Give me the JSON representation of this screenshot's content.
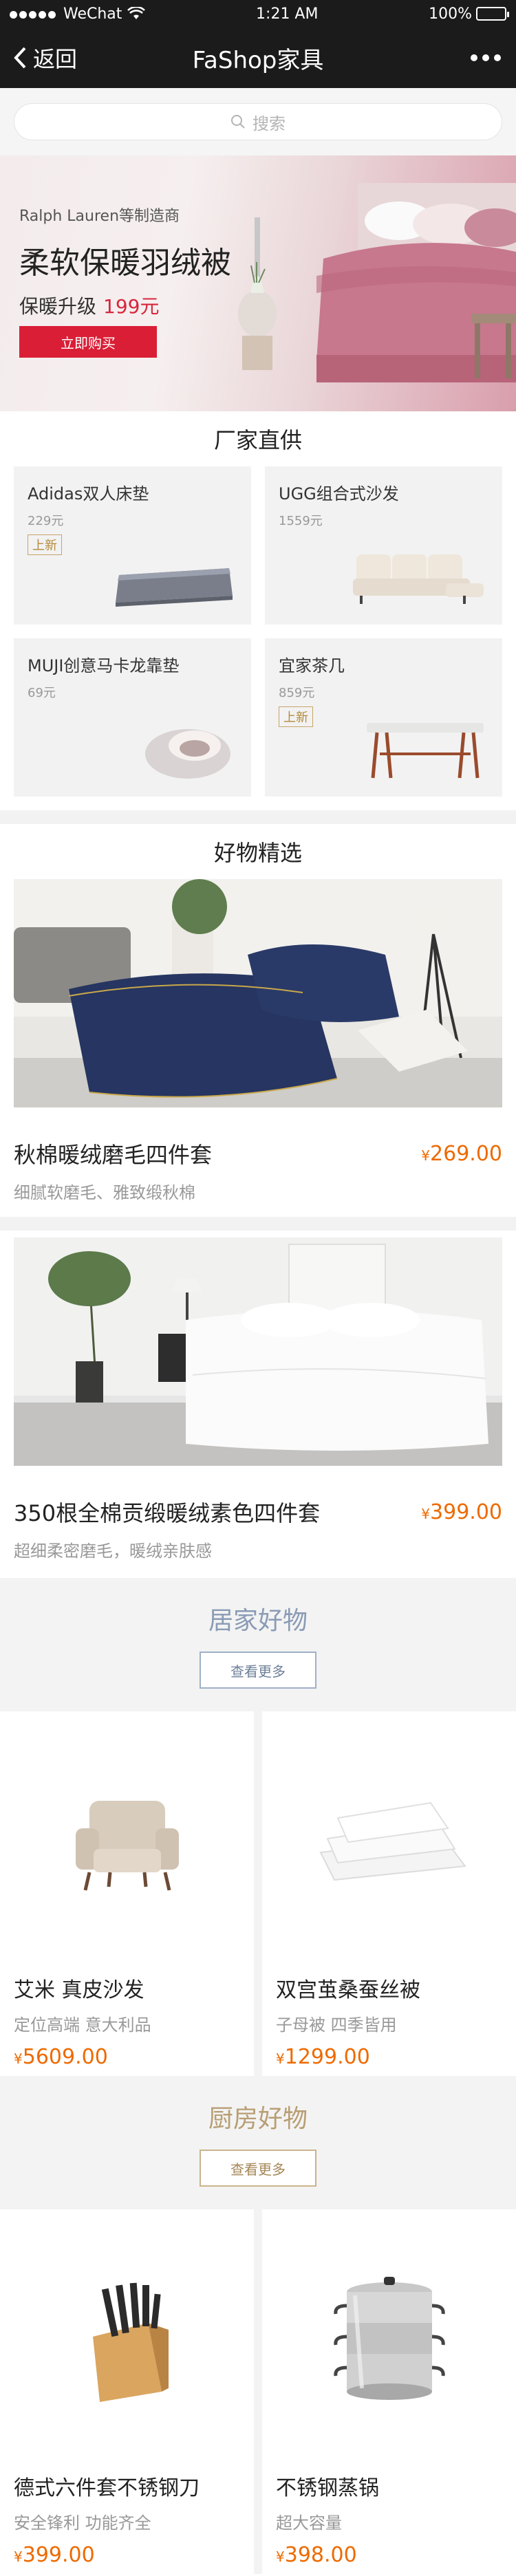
{
  "status_bar": {
    "carrier": "WeChat",
    "time": "1:21 AM",
    "battery": "100%"
  },
  "nav": {
    "back_label": "返回",
    "title": "FaShop家具"
  },
  "search": {
    "placeholder": "搜索"
  },
  "banner": {
    "subtitle": "Ralph Lauren等制造商",
    "title": "柔软保暖羽绒被",
    "price_label": "保暖升级",
    "price": "199元",
    "button": "立即购买"
  },
  "factory": {
    "heading": "厂家直供",
    "items": [
      {
        "name": "Adidas双人床垫",
        "price": "229元",
        "badge": "上新"
      },
      {
        "name": "UGG组合式沙发",
        "price": "1559元",
        "badge": ""
      },
      {
        "name": "MUJI创意马卡龙靠垫",
        "price": "69元",
        "badge": ""
      },
      {
        "name": "宜家茶几",
        "price": "859元",
        "badge": "上新"
      }
    ]
  },
  "featured": {
    "heading": "好物精选",
    "items": [
      {
        "title": "秋棉暖绒磨毛四件套",
        "currency": "¥",
        "price": "269.00",
        "desc": "细腻软磨毛、雅致缎秋棉"
      },
      {
        "title": "350根全棉贡缎暖绒素色四件套",
        "currency": "¥",
        "price": "399.00",
        "desc": "超细柔密磨毛，暖绒亲肤感"
      }
    ]
  },
  "home": {
    "heading": "居家好物",
    "more": "查看更多",
    "items": [
      {
        "name": "艾米 真皮沙发",
        "desc": "定位高端 意大利品",
        "currency": "¥",
        "price": "5609.00"
      },
      {
        "name": "双宫茧桑蚕丝被",
        "desc": "子母被 四季皆用",
        "currency": "¥",
        "price": "1299.00"
      }
    ]
  },
  "kitchen": {
    "heading": "厨房好物",
    "more": "查看更多",
    "items": [
      {
        "name": "德式六件套不锈钢刀",
        "desc": "安全锋利 功能齐全",
        "currency": "¥",
        "price": "399.00"
      },
      {
        "name": "不锈钢蒸锅",
        "desc": "超大容量",
        "currency": "¥",
        "price": "398.00"
      }
    ]
  },
  "colors": {
    "accent": "#ee6a00",
    "nav_bg": "#1b1b1b",
    "buy_button": "#d91e36"
  }
}
